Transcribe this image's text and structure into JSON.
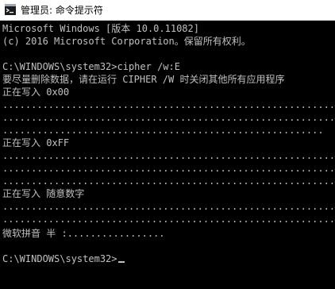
{
  "window": {
    "title": "管理员: 命令提示符",
    "icon": "cmd-icon"
  },
  "console": {
    "lines": [
      "Microsoft Windows [版本 10.0.11082]",
      "(c) 2016 Microsoft Corporation。保留所有权利。",
      "",
      "C:\\WINDOWS\\system32>cipher /w:E",
      "要尽量删除数据，请在运行 CIPHER /W 时关闭其他所有应用程序",
      "正在写入 0x00",
      "..............................................................",
      "..............................................................",
      "........................................................",
      "正在写入 0xFF",
      "..............................................................",
      "..............................................................",
      "..........................................................",
      "正在写入 随意数字",
      "..............................................................",
      "..............................................................",
      "微软拼音 半 :.................",
      "",
      "C:\\WINDOWS\\system32>"
    ]
  },
  "colors": {
    "console_bg": "#000000",
    "console_text": "#c0c0c0",
    "titlebar_bg": "#ffffff"
  }
}
